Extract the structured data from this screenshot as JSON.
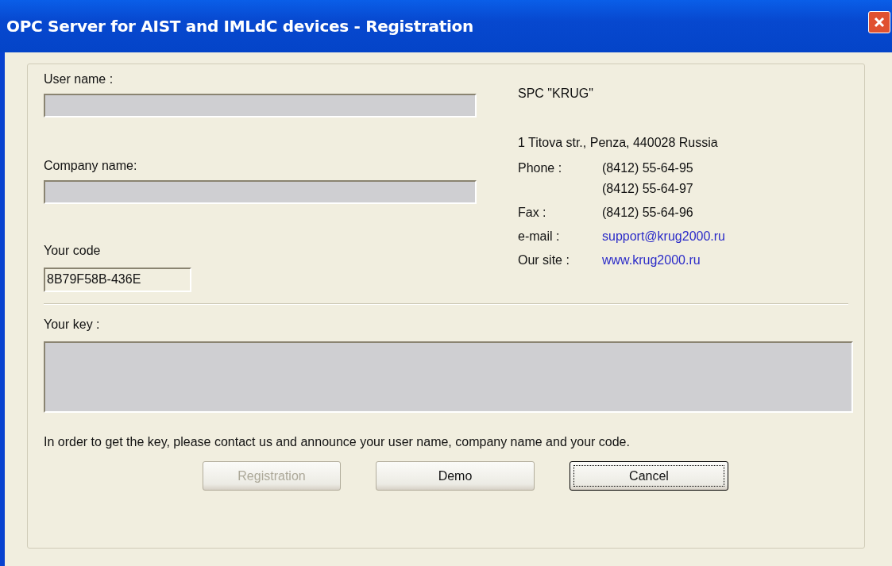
{
  "window": {
    "title": "OPC Server for AIST and IMLdC devices - Registration"
  },
  "fields": [
    {
      "label": "User name :",
      "disabled": true
    },
    {
      "label": "Company name:",
      "disabled": true
    }
  ],
  "code": {
    "label": "Your code",
    "value": "8B79F58B-436E"
  },
  "company": {
    "name": "SPC \"KRUG\"",
    "address": "1 Titova str., Penza, 440028 Russia",
    "contacts": [
      {
        "kind": "text",
        "label": "Phone :",
        "values": [
          "(8412) 55-64-95",
          "(8412) 55-64-97"
        ]
      },
      {
        "kind": "text",
        "label": "Fax :",
        "values": [
          "(8412) 55-64-96"
        ]
      },
      {
        "kind": "link",
        "label": "e-mail :",
        "values": [
          "support@krug2000.ru"
        ]
      },
      {
        "kind": "link",
        "label": "Our site :",
        "values": [
          "www.krug2000.ru"
        ]
      }
    ]
  },
  "key": {
    "label": "Your key :",
    "disabled": true
  },
  "hint": "In order to get the key, please contact us and announce your user name, company name and your code.",
  "buttons": [
    {
      "label": "Registration",
      "disabled": true,
      "focused": false
    },
    {
      "label": "Demo",
      "disabled": false,
      "focused": false
    },
    {
      "label": "Cancel",
      "disabled": false,
      "focused": true
    }
  ]
}
